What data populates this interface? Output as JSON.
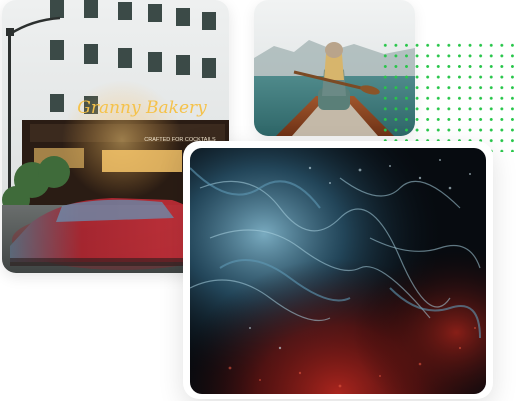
{
  "gallery": {
    "city_photo": {
      "sign_text": "Granny Bakery",
      "marquee_text": "CRAFTED FOR COCKTAILS"
    },
    "canoe_photo": {},
    "fluid_art_photo": {}
  },
  "colors": {
    "dot_accent": "#28c64a",
    "page_background": "#ffffff"
  }
}
